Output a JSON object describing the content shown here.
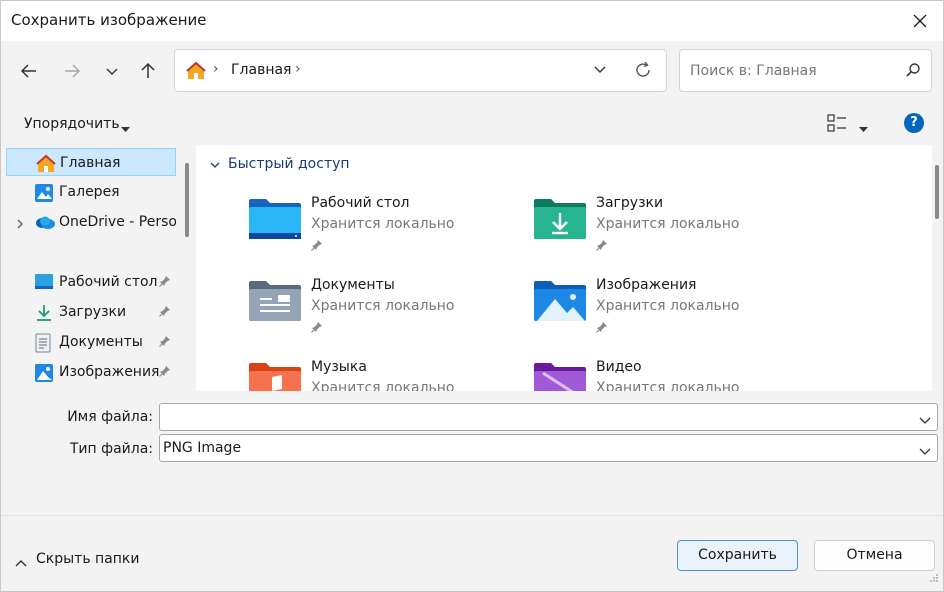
{
  "window": {
    "title": "Сохранить изображение"
  },
  "address": {
    "location": "Главная"
  },
  "search": {
    "placeholder": "Поиск в: Главная"
  },
  "toolbar": {
    "organize_label": "Упорядочить",
    "help": "?"
  },
  "sidebar": {
    "items": [
      {
        "label": "Главная",
        "icon": "home-icon"
      },
      {
        "label": "Галерея",
        "icon": "gallery-icon"
      },
      {
        "label": "OneDrive - Personal",
        "icon": "onedrive-icon"
      },
      {
        "label": "Рабочий стол",
        "icon": "desktop-icon"
      },
      {
        "label": "Загрузки",
        "icon": "downloads-icon"
      },
      {
        "label": "Документы",
        "icon": "documents-icon"
      },
      {
        "label": "Изображения",
        "icon": "pictures-icon"
      }
    ]
  },
  "content": {
    "group_title": "Быстрый доступ",
    "tiles": [
      {
        "name": "Рабочий стол",
        "status": "Хранится локально",
        "icon": "desktop-folder-icon"
      },
      {
        "name": "Загрузки",
        "status": "Хранится локально",
        "icon": "downloads-folder-icon"
      },
      {
        "name": "Документы",
        "status": "Хранится локально",
        "icon": "documents-folder-icon"
      },
      {
        "name": "Изображения",
        "status": "Хранится локально",
        "icon": "pictures-folder-icon"
      },
      {
        "name": "Музыка",
        "status": "Хранится локально",
        "icon": "music-folder-icon"
      },
      {
        "name": "Видео",
        "status": "Хранится локально",
        "icon": "video-folder-icon"
      }
    ]
  },
  "form": {
    "filename_label": "Имя файла:",
    "filename_value": "",
    "filetype_label": "Тип файла:",
    "filetype_value": "PNG Image"
  },
  "footer": {
    "hide_folders_label": "Скрыть папки",
    "save_label": "Сохранить",
    "cancel_label": "Отмена"
  },
  "colors": {
    "accent": "#0067c0",
    "selected_bg": "#cce8ff",
    "folder_blue": "#1e88e5"
  }
}
